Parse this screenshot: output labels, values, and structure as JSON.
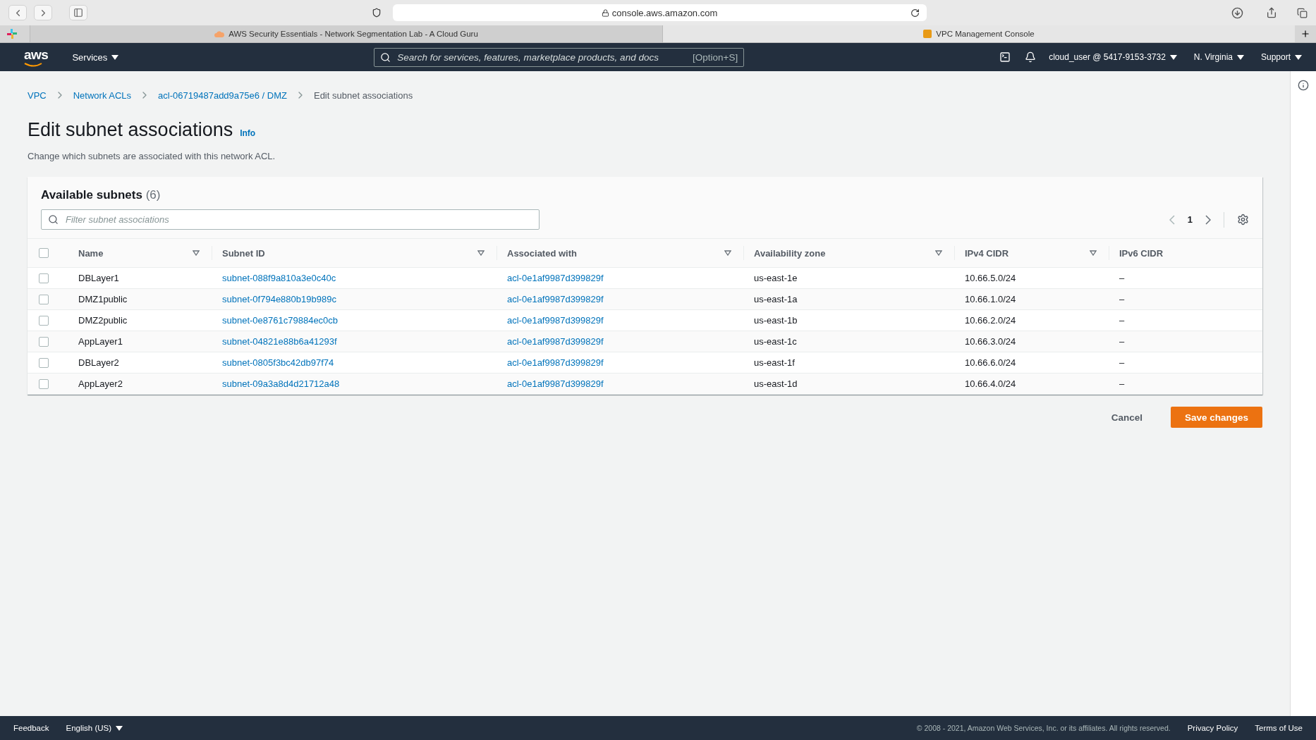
{
  "browser": {
    "url": "console.aws.amazon.com",
    "tabs": [
      {
        "title": "AWS Security Essentials - Network Segmentation Lab - A Cloud Guru",
        "selected": false
      },
      {
        "title": "VPC Management Console",
        "selected": true
      }
    ]
  },
  "navbar": {
    "logo": "aws",
    "services": "Services",
    "search_placeholder": "Search for services, features, marketplace products, and docs",
    "shortcut": "[Option+S]",
    "account": "cloud_user @ 5417-9153-3732",
    "region": "N. Virginia",
    "support": "Support"
  },
  "breadcrumbs": [
    "VPC",
    "Network ACLs",
    "acl-06719487add9a75e6 / DMZ",
    "Edit subnet associations"
  ],
  "page": {
    "title": "Edit subnet associations",
    "info": "Info",
    "description": "Change which subnets are associated with this network ACL."
  },
  "table": {
    "title": "Available subnets",
    "count": "(6)",
    "filter_placeholder": "Filter subnet associations",
    "page": "1",
    "all_checked": false,
    "columns": [
      {
        "label": "Name",
        "sortable": true
      },
      {
        "label": "Subnet ID",
        "sortable": true
      },
      {
        "label": "Associated with",
        "sortable": true
      },
      {
        "label": "Availability zone",
        "sortable": true
      },
      {
        "label": "IPv4 CIDR",
        "sortable": true
      },
      {
        "label": "IPv6 CIDR",
        "sortable": false
      }
    ],
    "rows": [
      {
        "checked": false,
        "name": "DBLayer1",
        "subnet_id": "subnet-088f9a810a3e0c40c",
        "associated_with": "acl-0e1af9987d399829f",
        "zone": "us-east-1e",
        "ipv4": "10.66.5.0/24",
        "ipv6": "–"
      },
      {
        "checked": false,
        "name": "DMZ1public",
        "subnet_id": "subnet-0f794e880b19b989c",
        "associated_with": "acl-0e1af9987d399829f",
        "zone": "us-east-1a",
        "ipv4": "10.66.1.0/24",
        "ipv6": "–"
      },
      {
        "checked": false,
        "name": "DMZ2public",
        "subnet_id": "subnet-0e8761c79884ec0cb",
        "associated_with": "acl-0e1af9987d399829f",
        "zone": "us-east-1b",
        "ipv4": "10.66.2.0/24",
        "ipv6": "–"
      },
      {
        "checked": false,
        "name": "AppLayer1",
        "subnet_id": "subnet-04821e88b6a41293f",
        "associated_with": "acl-0e1af9987d399829f",
        "zone": "us-east-1c",
        "ipv4": "10.66.3.0/24",
        "ipv6": "–"
      },
      {
        "checked": false,
        "name": "DBLayer2",
        "subnet_id": "subnet-0805f3bc42db97f74",
        "associated_with": "acl-0e1af9987d399829f",
        "zone": "us-east-1f",
        "ipv4": "10.66.6.0/24",
        "ipv6": "–"
      },
      {
        "checked": false,
        "name": "AppLayer2",
        "subnet_id": "subnet-09a3a8d4d21712a48",
        "associated_with": "acl-0e1af9987d399829f",
        "zone": "us-east-1d",
        "ipv4": "10.66.4.0/24",
        "ipv6": "–"
      }
    ]
  },
  "actions": {
    "cancel": "Cancel",
    "save": "Save changes"
  },
  "footer": {
    "feedback": "Feedback",
    "language": "English (US)",
    "copyright": "© 2008 - 2021, Amazon Web Services, Inc. or its affiliates. All rights reserved.",
    "privacy": "Privacy Policy",
    "terms": "Terms of Use"
  }
}
